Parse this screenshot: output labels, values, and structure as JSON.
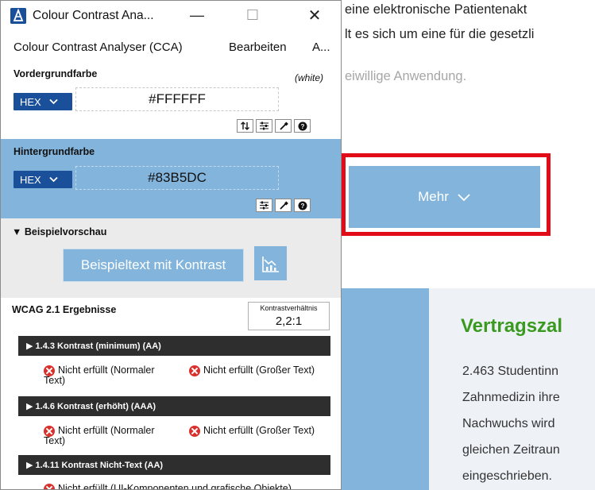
{
  "webpage": {
    "lines": [
      "eine elektronische Patientenakt",
      "lt es sich um eine für die gesetzli",
      "eiwillige Anwendung."
    ],
    "mehr_button": "Mehr",
    "section_title": "Vertragszal",
    "body_lines": [
      "2.463 Studentinn",
      "Zahnmedizin ihre",
      "Nachwuchs wird",
      "gleichen Zeitraun",
      "eingeschrieben."
    ],
    "accent_color": "#83B5DC",
    "title_color": "#3A9A20",
    "highlight_color": "#E20B18"
  },
  "window": {
    "title": "Colour Contrast Ana...",
    "controls": {
      "minimize": "—",
      "maximize": "☐",
      "close": "✕"
    }
  },
  "menu": {
    "items": [
      "Colour Contrast Analyser (CCA)",
      "Bearbeiten",
      "A..."
    ]
  },
  "foreground": {
    "label": "Vordergrundfarbe",
    "color_name": "(white)",
    "format": "HEX",
    "value": "#FFFFFF",
    "tools": [
      "swap-icon",
      "sliders-icon",
      "eyedropper-icon",
      "help-icon"
    ]
  },
  "background": {
    "label": "Hintergrundfarbe",
    "format": "HEX",
    "value": "#83B5DC",
    "tools": [
      "sliders-icon",
      "eyedropper-icon",
      "help-icon"
    ]
  },
  "preview": {
    "heading": "▼ Beispielvorschau",
    "sample_text": "Beispieltext mit Kontrast",
    "chart_icon": "chart-icon"
  },
  "results": {
    "heading": "WCAG 2.1 Ergebnisse",
    "ratio_label": "Kontrastverhältnis",
    "ratio_value": "2,2:1",
    "criteria": [
      {
        "title": "▶ 1.4.3 Kontrast (minimum) (AA)",
        "normal": [
          "Nicht erfüllt (Normaler",
          "Text)"
        ],
        "large": "Nicht erfüllt (Großer Text)"
      },
      {
        "title": "▶ 1.4.6 Kontrast (erhöht) (AAA)",
        "normal": [
          "Nicht erfüllt (Normaler",
          "Text)"
        ],
        "large": "Nicht erfüllt (Großer Text)"
      },
      {
        "title": "▶ 1.4.11 Kontrast Nicht-Text (AA)",
        "ui": "Nicht erfüllt (UI-Komponenten und grafische Objekte)"
      }
    ]
  }
}
